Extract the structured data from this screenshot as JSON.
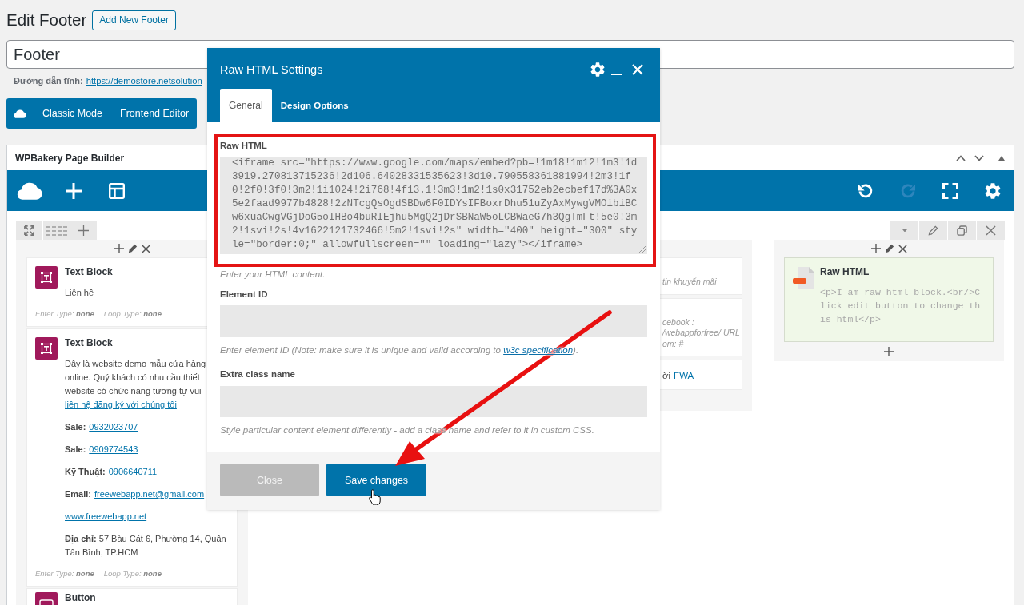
{
  "page": {
    "title": "Edit Footer",
    "add_new_button": "Add New Footer",
    "post_title": "Footer",
    "permalink": {
      "label": "Đường dẫn tĩnh:",
      "url": "https://demostore.netsolution"
    },
    "mode_buttons": [
      {
        "label": "Classic Mode"
      },
      {
        "label": "Frontend Editor"
      }
    ]
  },
  "builder": {
    "title": "WPBakery Page Builder",
    "redo_disabled": true,
    "columns": [
      {
        "controls": true,
        "elements": [
          {
            "kind": "text_block",
            "title": "Text Block",
            "content": [
              {
                "kind": "text",
                "text": "Liên hệ"
              }
            ],
            "meta": [
              "Enter Type: **none**",
              "Loop Type: **none**"
            ]
          },
          {
            "kind": "text_block",
            "title": "Text Block",
            "content": [
              {
                "kind": "paragraph",
                "text": "Đây là website demo mẫu cửa hàng online. Quý khách có nhu cầu thiết website có chức năng tương tự vui",
                "link": "liên hệ đăng ký với chúng tôi"
              },
              {
                "kind": "label_link",
                "label": "Sale:",
                "link": "0932023707"
              },
              {
                "kind": "label_link",
                "label": "Sale:",
                "link": "0909774543"
              },
              {
                "kind": "label_link",
                "label": "Kỹ Thuật:",
                "link": "0906640711"
              },
              {
                "kind": "label_link",
                "label": "Email:",
                "link": "freewebapp.net@gmail.com"
              },
              {
                "kind": "link",
                "text": "www.freewebapp.net"
              },
              {
                "kind": "rich_text",
                "text": "**Địa chỉ:** 57 Bàu Cát 6, Phường 14, Quận Tân Bình, TP.HCM"
              }
            ],
            "meta": [
              "Enter Type: **none**",
              "Loop Type: **none**"
            ]
          },
          {
            "kind": "button",
            "title": "Button"
          }
        ]
      },
      {
        "elements": [
          {
            "kind": "note",
            "lines": [
              "tin khuyến mãi"
            ]
          },
          {
            "kind": "note",
            "lines": [
              "cebook :",
              "/webappforfree/ URL",
              "om: #"
            ]
          },
          {
            "kind": "text_link",
            "text": "ời",
            "link": "FWA"
          }
        ]
      },
      {
        "controls": true,
        "add_button": true,
        "elements": [
          {
            "kind": "raw_html",
            "title": "Raw HTML",
            "code": "<p>I am raw html block.<br/>Click edit button to change this html</p>"
          }
        ]
      }
    ]
  },
  "modal": {
    "title": "Raw HTML Settings",
    "tabs": [
      {
        "label": "General",
        "selected": true
      },
      {
        "label": "Design Options",
        "selected": false
      }
    ],
    "fields": [
      {
        "kind": "code",
        "label": "Raw HTML",
        "value": "<iframe src=\"https://www.google.com/maps/embed?pb=!1m18!1m12!1m3!1d3919.270813715236!2d106.64028331535623!3d10.790558361881994!2m3!1f0!2f0!3f0!3m2!1i1024!2i768!4f13.1!3m3!1m2!1s0x31752eb2ecbef17d%3A0x5e2faad9977b4828!2zNTcgQsOgdSBDw6F0IDYsIFBoxrDhu51uZyAxMywgVMOibiBCw6xuaCwgVGjDoG5oIHBo4buRIEjhu5MgQ2jDrSBNaW5oLCBWaeG7h3QgTmFt!5e0!3m2!1svi!2s!4v1622121732466!5m2!1svi!2s\" width=\"400\" height=\"300\" style=\"border:0;\" allowfullscreen=\"\" loading=\"lazy\"></iframe>",
        "help": "Enter your HTML content."
      },
      {
        "kind": "text",
        "label": "Element ID",
        "help": "Enter element ID (Note: make sure it is unique and valid according to ",
        "help_link": "w3c specification",
        "help_end": ")."
      },
      {
        "kind": "text",
        "label": "Extra class name",
        "help": "Style particular content element differently - add a class name and refer to it in custom CSS."
      }
    ],
    "buttons": [
      {
        "kind": "secondary",
        "label": "Close"
      },
      {
        "kind": "primary",
        "label": "Save changes"
      }
    ]
  }
}
